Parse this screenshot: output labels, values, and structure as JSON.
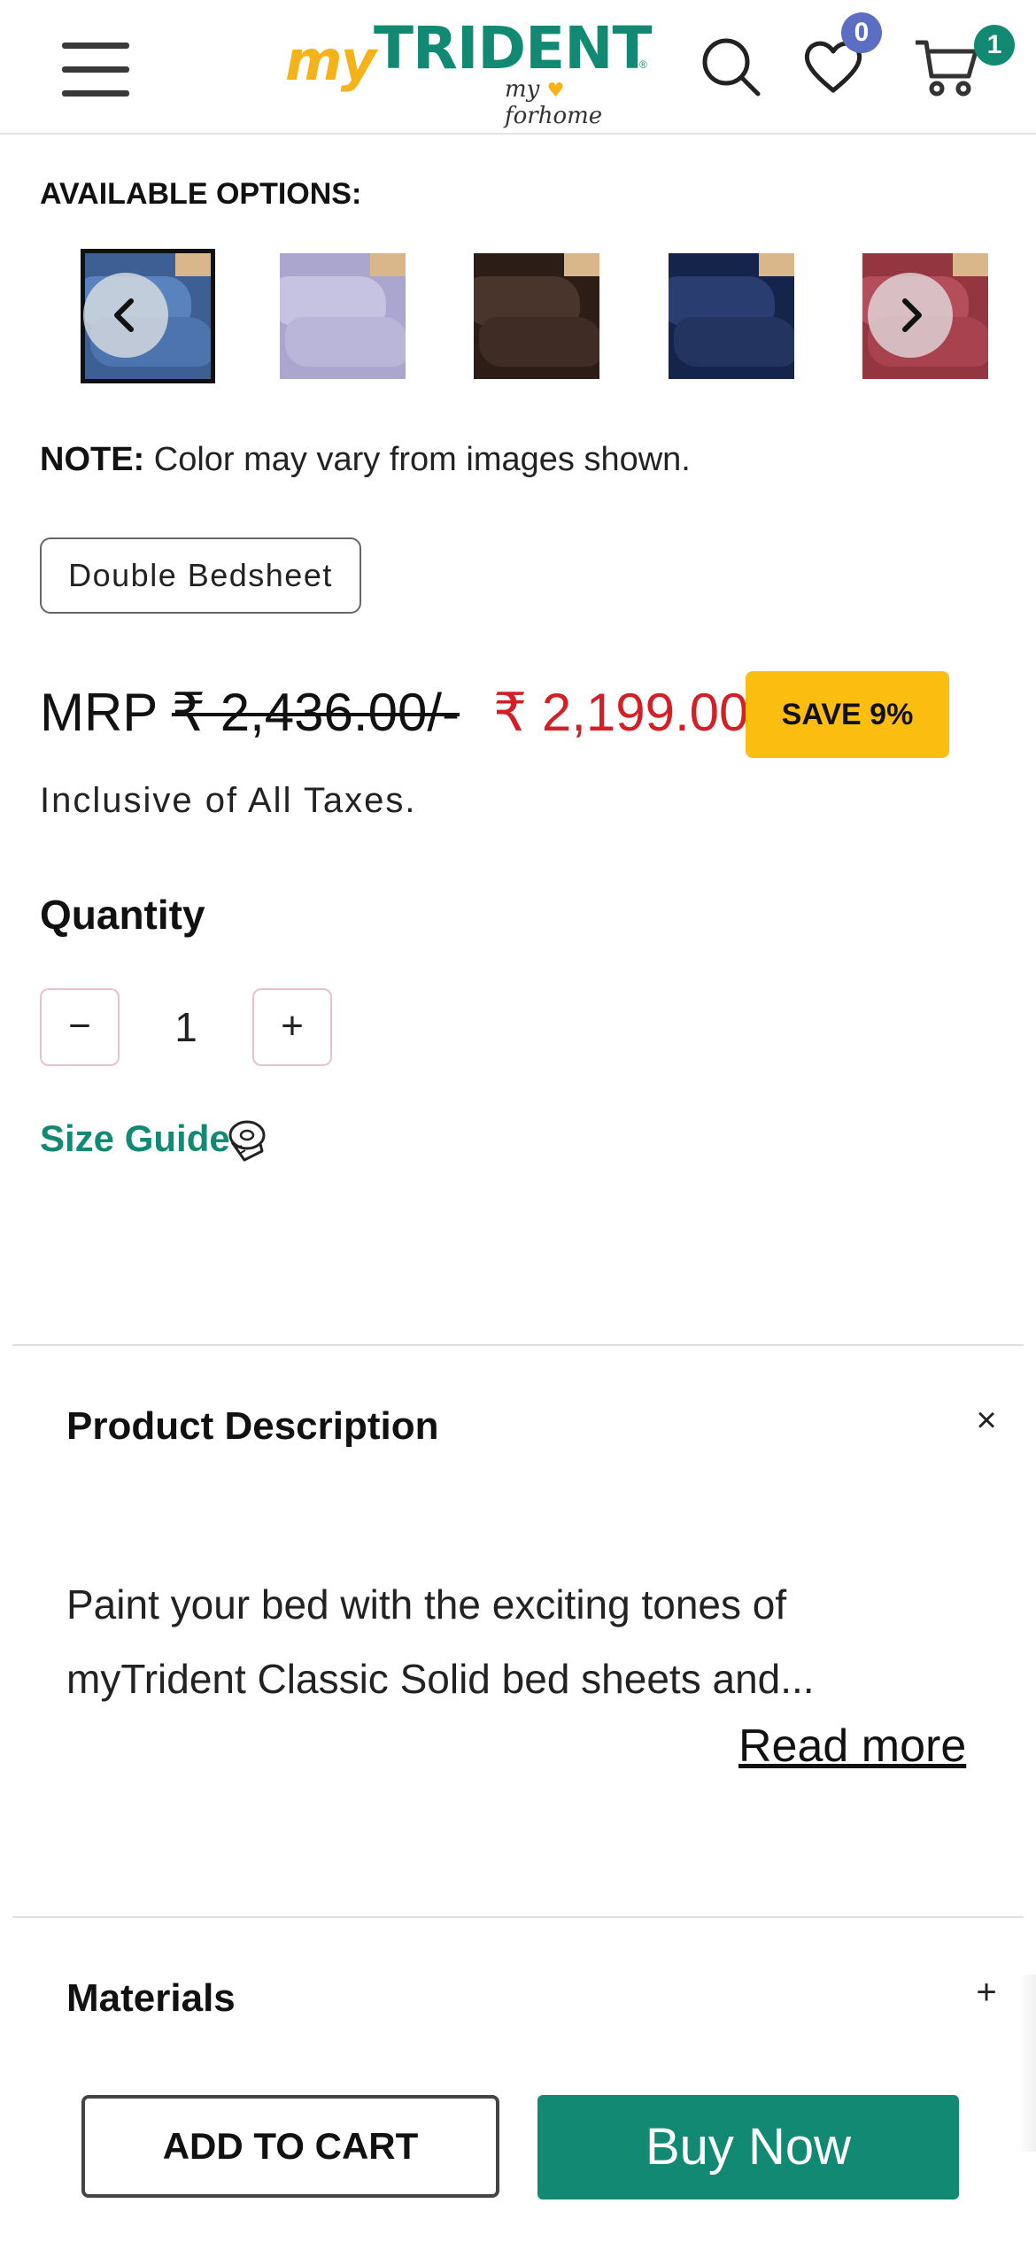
{
  "header": {
    "logo_my": "my",
    "logo_brand": "TRIDENT",
    "logo_tagline_my": "my",
    "logo_tagline_home": "forhome",
    "wishlist_count": "0",
    "cart_count": "1",
    "icons": {
      "menu": "hamburger-menu-icon",
      "search": "search-icon",
      "wishlist": "heart-icon",
      "cart": "cart-icon"
    },
    "colors": {
      "brand_green": "#128a73",
      "brand_yellow": "#f5b31b",
      "wishlist_badge": "#5b6ec4"
    }
  },
  "options": {
    "label": "AVAILABLE OPTIONS:",
    "swatches": [
      {
        "color_name": "blue",
        "color": "#4a6fa8",
        "selected": true
      },
      {
        "color_name": "lavender",
        "color": "#b8b4d8",
        "selected": false
      },
      {
        "color_name": "brown",
        "color": "#3d2a22",
        "selected": false
      },
      {
        "color_name": "navy",
        "color": "#1e2f5c",
        "selected": false
      },
      {
        "color_name": "maroon",
        "color": "#a8424f",
        "selected": false
      }
    ]
  },
  "note": {
    "bold": "NOTE:",
    "text": " Color may vary from images shown."
  },
  "variant": {
    "label": "Double Bedsheet"
  },
  "price": {
    "mrp_label": "MRP ",
    "mrp_value": "₹ 2,436.00/-",
    "sale_price": "₹ 2,199.00",
    "save_badge": "SAVE 9%",
    "taxes_note": "Inclusive of All Taxes.",
    "sale_color": "#d32027",
    "save_color": "#fbbd0f"
  },
  "quantity": {
    "label": "Quantity",
    "minus": "−",
    "value": "1",
    "plus": "+"
  },
  "size_guide": {
    "label": "Size Guide",
    "icon": "measuring-tape-icon"
  },
  "description": {
    "title": "Product Description",
    "toggle": "×",
    "text": "Paint your bed with the exciting tones of myTrident Classic Solid bed sheets and...",
    "read_more": "Read more"
  },
  "materials": {
    "title": "Materials",
    "toggle": "+"
  },
  "actions": {
    "add_to_cart": "ADD TO CART",
    "buy_now": "Buy Now",
    "buy_color": "#128a73"
  }
}
